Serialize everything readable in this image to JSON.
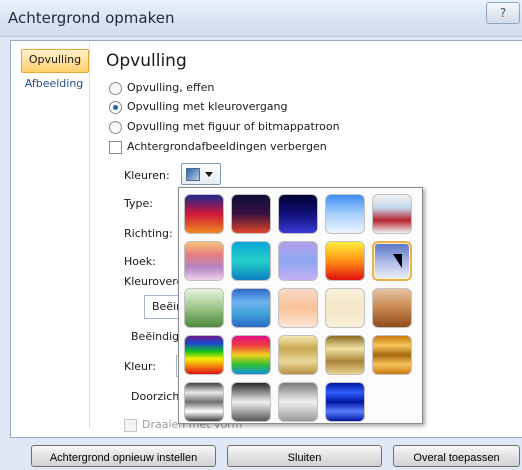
{
  "window": {
    "title": "Achtergrond opmaken",
    "help_label": "?"
  },
  "nav": {
    "items": [
      {
        "label": "Opvulling"
      },
      {
        "label": "Afbeelding"
      }
    ]
  },
  "pane": {
    "heading": "Opvulling",
    "options": [
      {
        "label": "Opvulling, effen",
        "selected": false
      },
      {
        "label": "Opvulling met kleurovergang",
        "selected": true
      },
      {
        "label": "Opvulling met figuur of bitmappatroon",
        "selected": false
      }
    ],
    "hide_bg_label": "Achtergrondafbeeldingen verbergen",
    "kleuren_label": "Kleuren:",
    "type_label": "Type:",
    "richting_label": "Richting:",
    "hoek_label": "Hoek:",
    "kleurovergang_label": "Kleurovergang",
    "beeindig_value": "Beëind",
    "beeindiging_label": "Beëindigi",
    "kleur_label": "Kleur:",
    "doorzicht_label": "Doorzicht",
    "draaien_label": "Draaien met vorm"
  },
  "gradients": {
    "rows": [
      [
        "#1d2a8f,#d2173b,#f08a20",
        "#0d0d3a,#3a1140,#e0452a",
        "#000033,#10107a,#3b3bd8",
        "#3c8ef5,#a8d0fb,#eaf4ff",
        "#f1f1f1,#c4d9ee,#b5242d,#f1f1f1"
      ],
      [
        "#f6c37a,#e77f7f,#b684c7,#f0d0e8",
        "#0aa6d6,#25d0c9,#0a7fc0",
        "#b39ce8,#8ea8f2,#c4b0f5",
        "#ffef3a,#ff9015,#e01010",
        "#5a73c4,#a8b6e6,#eef1fb"
      ],
      [
        "#e8f4df,#9cc48a,#4c8a3a",
        "#2b68c9,#6fb3ee,#3fa0d8,#2b68c9",
        "#f5d9c5,#f8c199,#fce6d6",
        "#f9f1dc,#f3e6c5,#f9f1dc",
        "#e6c2a4,#c8874e,#8f4a1b"
      ],
      [
        "#6a1a8a,#1a4ad0,#10c020,#f6f000,#f08010,#e01010",
        "#e01080,#f04040,#f0d020,#30c030,#1090e0",
        "#f4e8b0,#c9a855,#e8d79a,#b89240",
        "#8a6a20,#f3e3a6,#a8843a,#e8d28e",
        "#c87a10,#f6c55a,#a86a10,#f6c55a,#c87a10"
      ],
      [
        "#404040,#e8e8e8,#707070,#ffffff,#404040",
        "#2a2a2a,#f0f0f0,#555555",
        "#7a7a7a,#f0f0f0,#9a9a9a",
        "#0018a0,#2f5cff,#0018a0,#5a7dff,#0018a0",
        ""
      ]
    ]
  },
  "buttons": {
    "reset_label": "Achtergrond opnieuw instellen",
    "close_label": "Sluiten",
    "apply_all_label": "Overal toepassen"
  }
}
